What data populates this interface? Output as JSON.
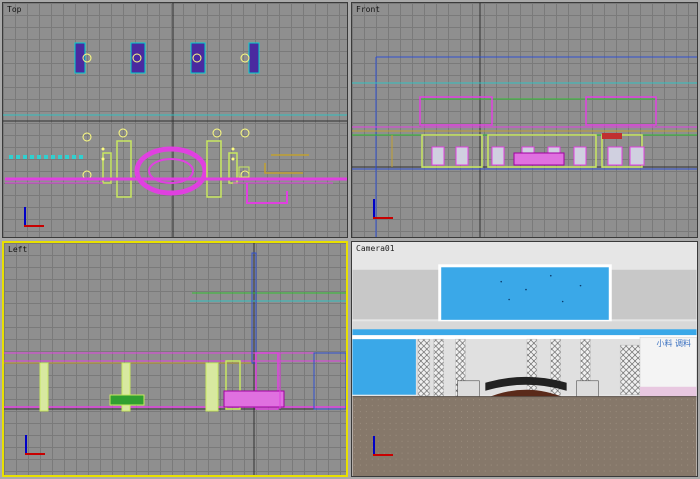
{
  "viewports": {
    "top": {
      "label": "Top"
    },
    "front": {
      "label": "Front"
    },
    "left": {
      "label": "Left"
    },
    "camera": {
      "label": "Camera01"
    }
  },
  "camera_signage": {
    "right_sign": "小料 调料"
  },
  "active_viewport": "left",
  "colors": {
    "viewport_bg": "#8f8f8f",
    "grid_line": "#7a7a7a",
    "active_border": "#e8e000",
    "magenta": "#e040e0",
    "cyan": "#00c8c8",
    "yellow_green": "#c8e860",
    "ceiling_blue": "#3aa8e8",
    "floor": "#8a7a66"
  }
}
